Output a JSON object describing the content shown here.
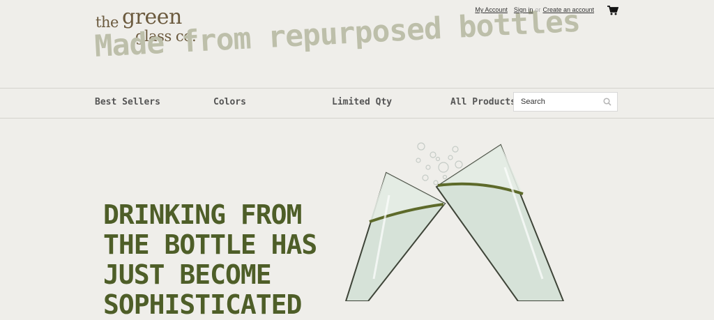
{
  "brand": {
    "logo_the": "the",
    "logo_green": "green",
    "logo_glass": "glass co.",
    "tagline": "Made from repurposed bottles"
  },
  "account_links": {
    "my_account": "My Account",
    "sign_in": "Sign in",
    "separator": "or",
    "create_account": "Create an account"
  },
  "nav": {
    "items": [
      {
        "label": "Best Sellers"
      },
      {
        "label": "Colors"
      },
      {
        "label": "Limited Qty"
      },
      {
        "label": "All Products"
      }
    ]
  },
  "search": {
    "placeholder": "Search"
  },
  "hero": {
    "lines": [
      "DRINKING FROM",
      "THE BOTTLE HAS",
      "JUST BECOME",
      "SOPHISTICATED"
    ]
  },
  "colors": {
    "background": "#efeeea",
    "logo_brown": "#6b5a3e",
    "tagline_gray": "#bdbfaa",
    "hero_green": "#4e5e28",
    "glass_fill": "#cfdcd2",
    "liquid_line": "#5d6a2a"
  },
  "icons": {
    "cart": "shopping-cart-icon",
    "search": "search-icon"
  }
}
